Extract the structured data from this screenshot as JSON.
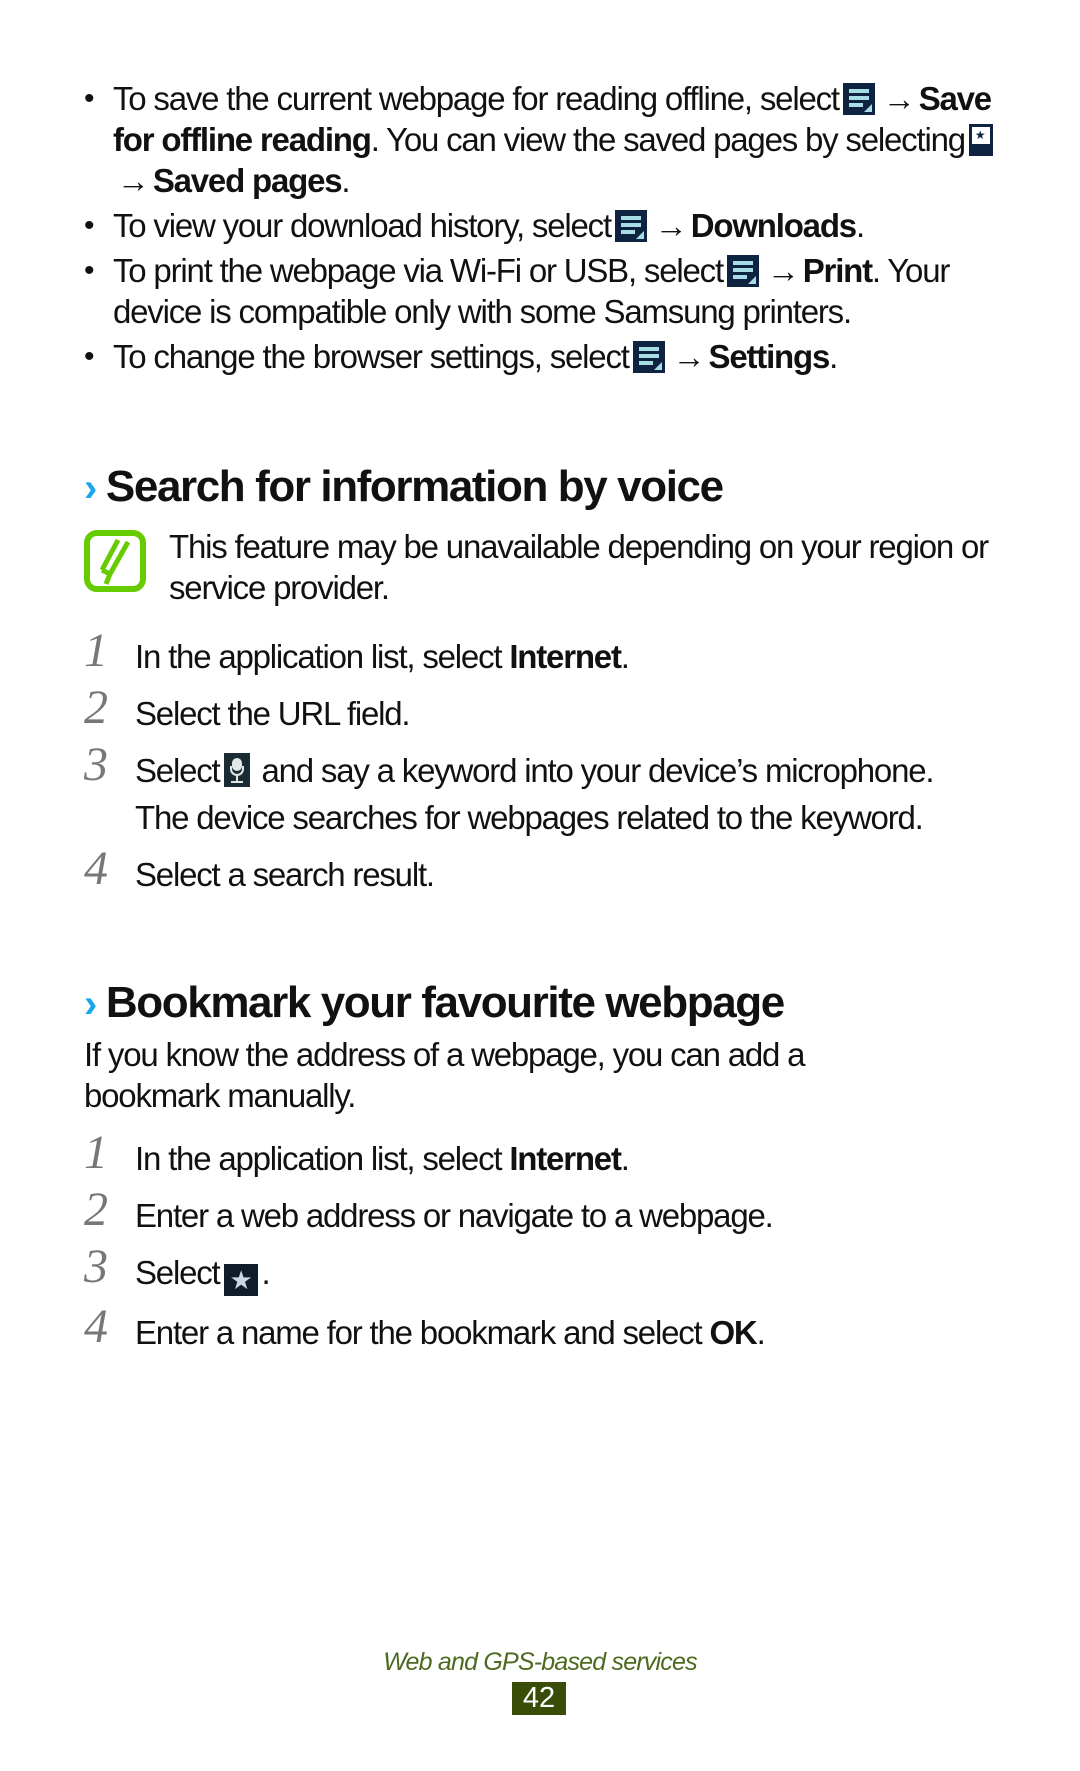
{
  "bullets": [
    {
      "t1": "To save the current webpage for reading offline, select",
      "icon1": "menu-icon",
      "arrow1": "→",
      "b1": "Save for offline reading",
      "t2": ". You can view the saved pages by selecting",
      "icon2": "saved-pages-icon",
      "arrow2": "→",
      "b2": "Saved pages",
      "t3": "."
    },
    {
      "t1": "To view your download history, select",
      "icon1": "menu-icon",
      "arrow1": "→",
      "b1": "Downloads",
      "t2": "."
    },
    {
      "t1": "To print the webpage via Wi-Fi or USB, select",
      "icon1": "menu-icon",
      "arrow1": "→",
      "b1": "Print",
      "t2": ". Your device is compatible only with some Samsung printers."
    },
    {
      "t1": "To change the browser settings, select",
      "icon1": "menu-icon",
      "arrow1": "→",
      "b1": "Settings",
      "t2": "."
    }
  ],
  "section1": {
    "chevron": "›",
    "title": "Search for information by voice",
    "note": "This feature may be unavailable depending on your region or service provider.",
    "steps": [
      {
        "num": "1",
        "pre": "In the application list, select ",
        "bold": "Internet",
        "post": "."
      },
      {
        "num": "2",
        "pre": "Select the URL field."
      },
      {
        "num": "3",
        "pre": "Select",
        "icon": "microphone-icon",
        "post": " and say a keyword into your device’s microphone.",
        "sub": "The device searches for webpages related to the keyword."
      },
      {
        "num": "4",
        "pre": "Select a search result."
      }
    ]
  },
  "section2": {
    "chevron": "›",
    "title": "Bookmark your favourite webpage",
    "intro": "If you know the address of a webpage, you can add a bookmark manually.",
    "steps": [
      {
        "num": "1",
        "pre": "In the application list, select ",
        "bold": "Internet",
        "post": "."
      },
      {
        "num": "2",
        "pre": "Enter a web address or navigate to a webpage."
      },
      {
        "num": "3",
        "pre": "Select",
        "icon": "star-icon",
        "post": "."
      },
      {
        "num": "4",
        "pre": "Enter a name for the bookmark and select ",
        "bold": "OK",
        "post": "."
      }
    ]
  },
  "footer": {
    "section_title": "Web and GPS-based services",
    "page_number": "42"
  },
  "colors": {
    "accent": "#1aa7e8",
    "note_icon": "#66cc00",
    "footer_text": "#4d6a1f",
    "page_badge": "#3a4d08"
  }
}
